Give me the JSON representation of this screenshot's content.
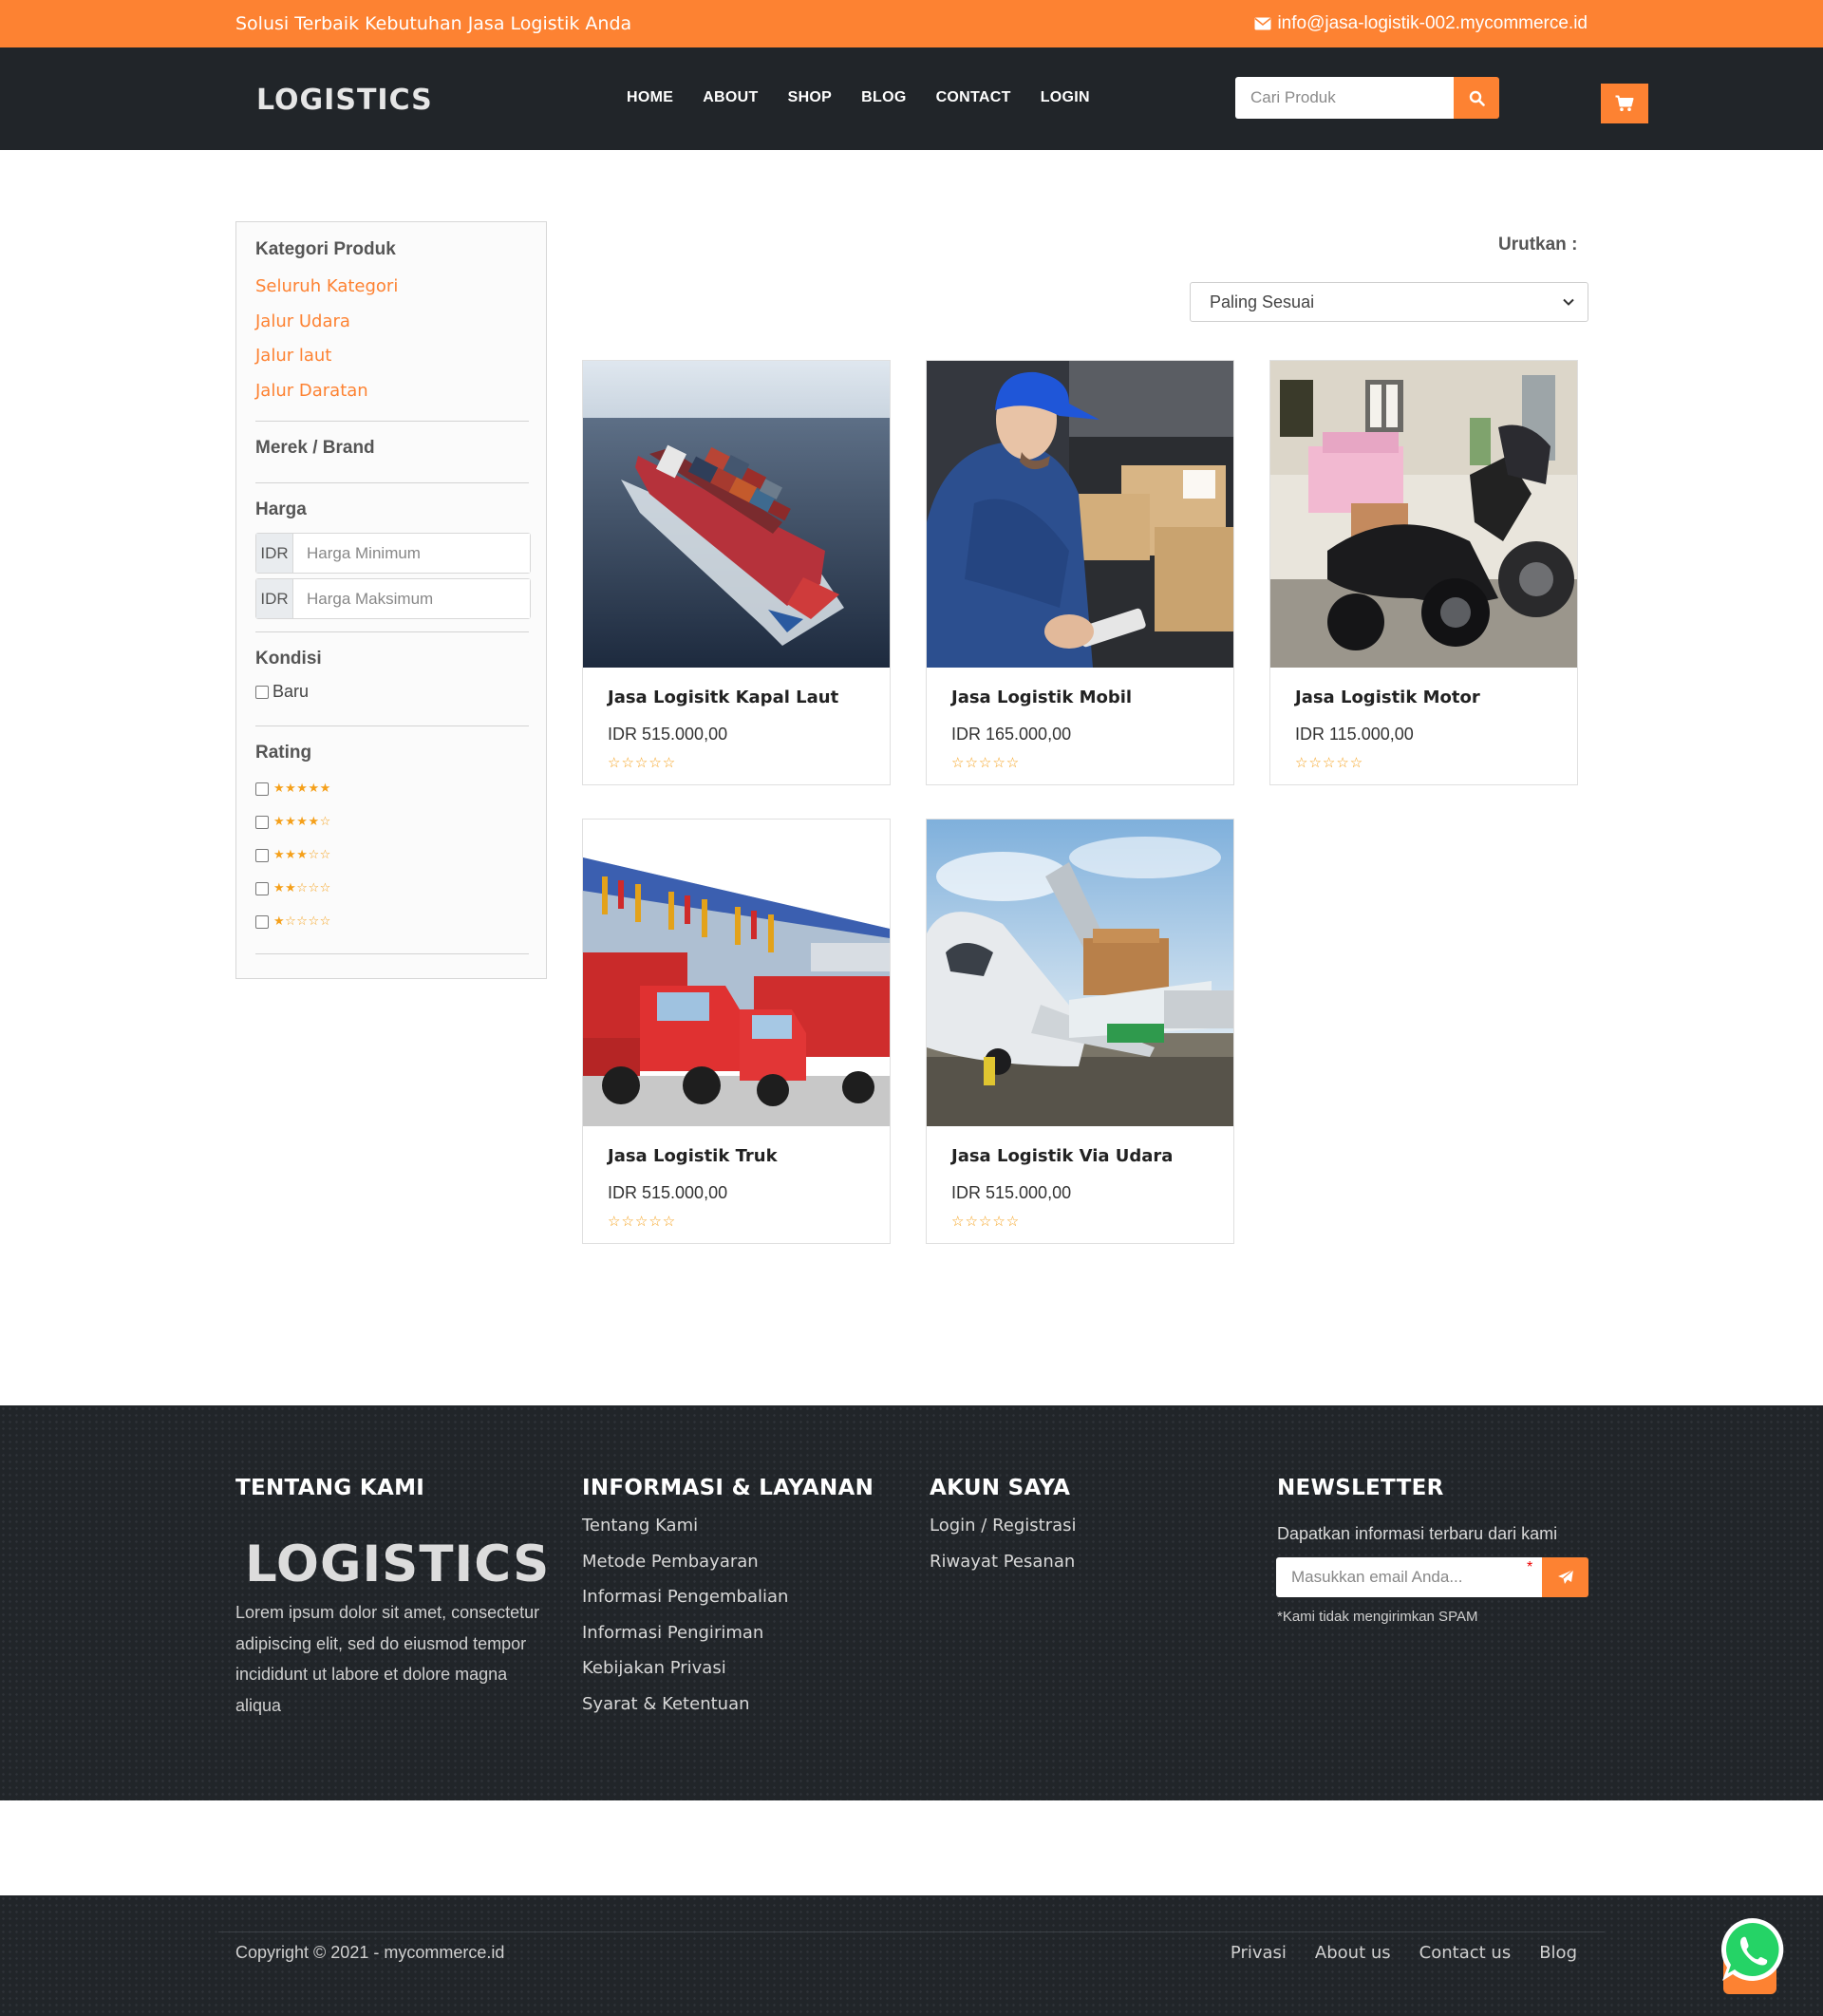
{
  "topbar": {
    "tagline": "Solusi Terbaik Kebutuhan Jasa Logistik Anda",
    "email": "info@jasa-logistik-002.mycommerce.id",
    "email_icon": "envelope-icon"
  },
  "header": {
    "logo": "LOGISTICS",
    "nav": [
      "HOME",
      "ABOUT",
      "SHOP",
      "BLOG",
      "CONTACT",
      "LOGIN"
    ],
    "search_placeholder": "Cari Produk",
    "search_icon": "search-icon",
    "cart_icon": "cart-icon"
  },
  "sidebar": {
    "category_title": "Kategori Produk",
    "categories": [
      "Seluruh Kategori",
      "Jalur Udara",
      "Jalur laut",
      "Jalur Daratan"
    ],
    "brand_title": "Merek / Brand",
    "price_title": "Harga",
    "currency": "IDR",
    "min_placeholder": "Harga Minimum",
    "max_placeholder": "Harga Maksimum",
    "condition_title": "Kondisi",
    "condition_new": "Baru",
    "rating_title": "Rating",
    "rating_options": [
      "★★★★★",
      "★★★★☆",
      "★★★☆☆",
      "★★☆☆☆",
      "★☆☆☆☆"
    ]
  },
  "sort": {
    "label": "Urutkan :",
    "selected": "Paling Sesuai"
  },
  "products": [
    {
      "name": "Jasa Logisitk Kapal Laut",
      "price": "IDR 515.000,00",
      "rating": "☆☆☆☆☆"
    },
    {
      "name": "Jasa Logistik Mobil",
      "price": "IDR 165.000,00",
      "rating": "☆☆☆☆☆"
    },
    {
      "name": "Jasa Logistik Motor",
      "price": "IDR 115.000,00",
      "rating": "☆☆☆☆☆"
    },
    {
      "name": "Jasa Logistik Truk",
      "price": "IDR 515.000,00",
      "rating": "☆☆☆☆☆"
    },
    {
      "name": "Jasa Logistik Via Udara",
      "price": "IDR 515.000,00",
      "rating": "☆☆☆☆☆"
    }
  ],
  "footer": {
    "about_title": "TENTANG KAMI",
    "logo": "LOGISTICS",
    "about_text": "Lorem ipsum dolor sit amet, consectetur adipiscing elit, sed do eiusmod tempor incididunt ut labore et dolore magna aliqua",
    "info_title": "INFORMASI & LAYANAN",
    "info_links": [
      "Tentang Kami",
      "Metode Pembayaran",
      "Informasi Pengembalian",
      "Informasi Pengiriman",
      "Kebijakan Privasi",
      "Syarat & Ketentuan"
    ],
    "account_title": "AKUN SAYA",
    "account_links": [
      "Login / Registrasi",
      "Riwayat Pesanan"
    ],
    "newsletter_title": "NEWSLETTER",
    "newsletter_text": "Dapatkan informasi terbaru dari kami",
    "newsletter_placeholder": "Masukkan email Anda...",
    "required_mark": "*",
    "nospam": "*Kami tidak mengirimkan SPAM",
    "send_icon": "paper-plane-icon"
  },
  "bottom": {
    "copyright": "Copyright © 2021 - mycommerce.id",
    "links": [
      "Privasi",
      "About us",
      "Contact us",
      "Blog"
    ],
    "whatsapp_icon": "whatsapp-icon"
  },
  "colors": {
    "accent": "#fd8232",
    "dark": "#212529"
  }
}
